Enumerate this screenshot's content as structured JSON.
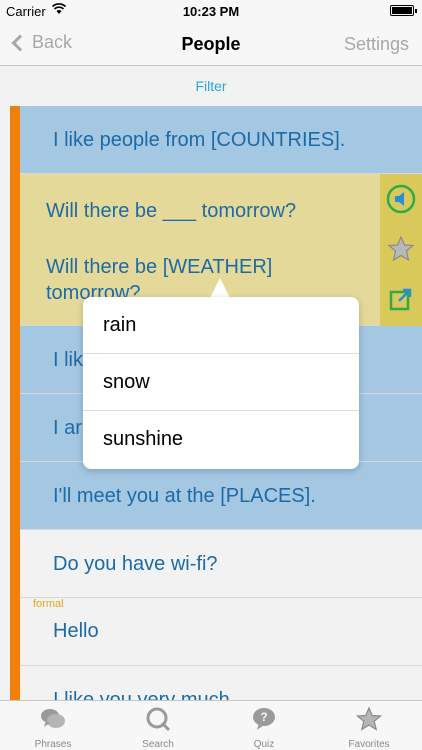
{
  "status": {
    "carrier": "Carrier",
    "time": "10:23 PM"
  },
  "nav": {
    "back_label": "Back",
    "title": "People",
    "settings_label": "Settings"
  },
  "filter": {
    "label": "Filter"
  },
  "rows": [
    {
      "text": "I like people from [COUNTRIES]."
    },
    {
      "line1": "Will there be ___ tomorrow?",
      "line2": "Will there be [WEATHER] tomorrow?"
    },
    {
      "text": "I lik"
    },
    {
      "text": "I ar"
    },
    {
      "text": "I'll meet you at the [PLACES]."
    },
    {
      "text": "Do you have wi-fi?"
    },
    {
      "tag": "formal",
      "text": "Hello"
    },
    {
      "text": "I like you very much."
    }
  ],
  "popover": {
    "options": [
      "rain",
      "snow",
      "sunshine"
    ]
  },
  "tabs": [
    {
      "label": "Phrases"
    },
    {
      "label": "Search"
    },
    {
      "label": "Quiz"
    },
    {
      "label": "Favorites"
    }
  ],
  "colors": {
    "accent": "#f0800a",
    "link": "#2aa6d8",
    "row_blue": "#a4c7e2",
    "row_yellow": "#e5d99a",
    "text_blue": "#1c6aa8"
  }
}
